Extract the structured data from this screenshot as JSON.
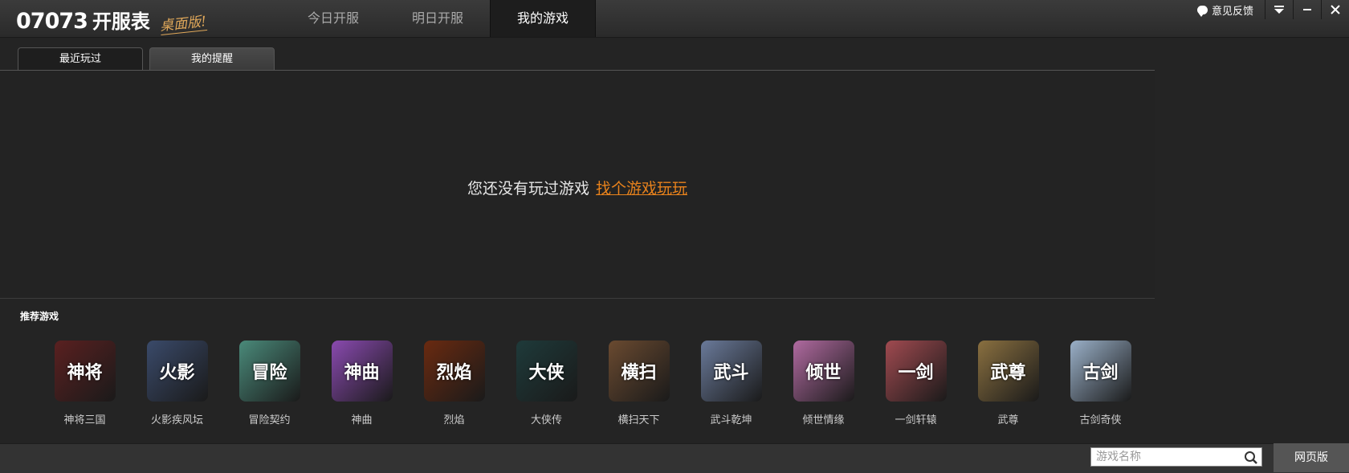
{
  "app": {
    "logo_number": "07073",
    "logo_title": "开服表",
    "logo_sub": "桌面版!"
  },
  "nav": {
    "tabs": [
      {
        "label": "今日开服",
        "active": false
      },
      {
        "label": "明日开服",
        "active": false
      },
      {
        "label": "我的游戏",
        "active": true
      }
    ]
  },
  "window": {
    "feedback_label": "意见反馈"
  },
  "subtabs": [
    {
      "label": "最近玩过",
      "active": true
    },
    {
      "label": "我的提醒",
      "active": false
    }
  ],
  "empty": {
    "message": "您还没有玩过游戏",
    "link": "找个游戏玩玩"
  },
  "recommended": {
    "title": "推荐游戏",
    "games": [
      {
        "name": "神将三国",
        "icon_text": "神将",
        "color": "#5a2020"
      },
      {
        "name": "火影疾风坛",
        "icon_text": "火影",
        "color": "#3a4a6a"
      },
      {
        "name": "冒险契约",
        "icon_text": "冒险",
        "color": "#4a8a7a"
      },
      {
        "name": "神曲",
        "icon_text": "神曲",
        "color": "#8a4ab0"
      },
      {
        "name": "烈焰",
        "icon_text": "烈焰",
        "color": "#6a2a10"
      },
      {
        "name": "大侠传",
        "icon_text": "大侠",
        "color": "#1e3a3a"
      },
      {
        "name": "横扫天下",
        "icon_text": "横扫",
        "color": "#6a4a30"
      },
      {
        "name": "武斗乾坤",
        "icon_text": "武斗",
        "color": "#6a7a9a"
      },
      {
        "name": "倾世情缘",
        "icon_text": "倾世",
        "color": "#b06aa0"
      },
      {
        "name": "一剑轩辕",
        "icon_text": "一剑",
        "color": "#a04a50"
      },
      {
        "name": "武尊",
        "icon_text": "武尊",
        "color": "#8a7040"
      },
      {
        "name": "古剑奇侠",
        "icon_text": "古剑",
        "color": "#9ab0c8"
      }
    ]
  },
  "bottom": {
    "search_placeholder": "游戏名称",
    "web_button": "网页版"
  }
}
